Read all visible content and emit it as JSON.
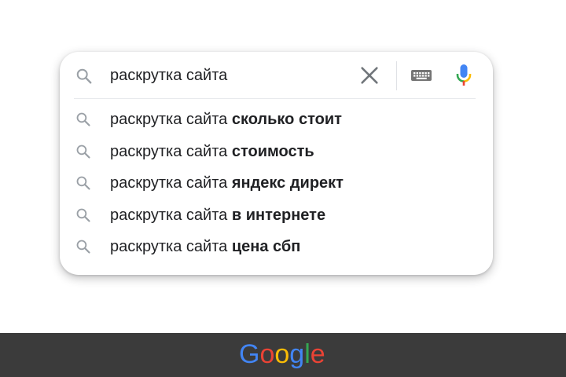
{
  "search": {
    "query": "раскрутка сайта",
    "icons": {
      "search": "search-icon",
      "clear": "close-icon",
      "keyboard": "keyboard-icon",
      "voice": "microphone-icon"
    }
  },
  "suggestions": [
    {
      "prefix": "раскрутка сайта ",
      "completion": "сколько стоит"
    },
    {
      "prefix": "раскрутка сайта ",
      "completion": "стоимость"
    },
    {
      "prefix": "раскрутка сайта ",
      "completion": "яндекс директ"
    },
    {
      "prefix": "раскрутка сайта ",
      "completion": "в интернете"
    },
    {
      "prefix": "раскрутка сайта ",
      "completion": "цена сбп"
    }
  ],
  "footer": {
    "logo_text": "Google",
    "logo_colors": [
      "#4285F4",
      "#EA4335",
      "#FBBC05",
      "#4285F4",
      "#34A853",
      "#EA4335"
    ],
    "background": "#3b3b3b"
  },
  "colors": {
    "icon_gray": "#9aa0a6",
    "text": "#202124",
    "mic_blue": "#4285F4",
    "mic_red": "#EA4335",
    "mic_yellow": "#FBBC05",
    "mic_green": "#34A853"
  }
}
